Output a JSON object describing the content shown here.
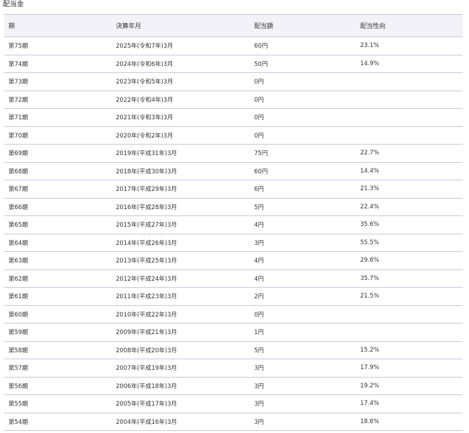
{
  "section_title": "配当金",
  "headers": [
    "期",
    "決算年月",
    "配当額",
    "配当性向"
  ],
  "rows": [
    {
      "period": "第75期",
      "fiscal": "2025年(令和7年)3月",
      "dividend": "60円",
      "payout": "23.1%"
    },
    {
      "period": "第74期",
      "fiscal": "2024年(令和6年)3月",
      "dividend": "50円",
      "payout": "14.9%"
    },
    {
      "period": "第73期",
      "fiscal": "2023年(令和5年)3月",
      "dividend": "0円",
      "payout": ""
    },
    {
      "period": "第72期",
      "fiscal": "2022年(令和4年)3月",
      "dividend": "0円",
      "payout": ""
    },
    {
      "period": "第71期",
      "fiscal": "2021年(令和3年)3月",
      "dividend": "0円",
      "payout": ""
    },
    {
      "period": "第70期",
      "fiscal": "2020年(令和2年)3月",
      "dividend": "0円",
      "payout": ""
    },
    {
      "period": "第69期",
      "fiscal": "2019年(平成31年)3月",
      "dividend": "75円",
      "payout": "22.7%"
    },
    {
      "period": "第68期",
      "fiscal": "2018年(平成30年)3月",
      "dividend": "60円",
      "payout": "14.4%"
    },
    {
      "period": "第67期",
      "fiscal": "2017年(平成29年)3月",
      "dividend": "6円",
      "payout": "21.3%"
    },
    {
      "period": "第66期",
      "fiscal": "2016年(平成28年)3月",
      "dividend": "5円",
      "payout": "22.4%"
    },
    {
      "period": "第65期",
      "fiscal": "2015年(平成27年)3月",
      "dividend": "4円",
      "payout": "35.6%"
    },
    {
      "period": "第64期",
      "fiscal": "2014年(平成26年)3月",
      "dividend": "3円",
      "payout": "55.5%"
    },
    {
      "period": "第63期",
      "fiscal": "2013年(平成25年)3月",
      "dividend": "4円",
      "payout": "29.6%"
    },
    {
      "period": "第62期",
      "fiscal": "2012年(平成24年)3月",
      "dividend": "4円",
      "payout": "35.7%"
    },
    {
      "period": "第61期",
      "fiscal": "2011年(平成23年)3月",
      "dividend": "2円",
      "payout": "21.5%"
    },
    {
      "period": "第60期",
      "fiscal": "2010年(平成22年)3月",
      "dividend": "0円",
      "payout": ""
    },
    {
      "period": "第59期",
      "fiscal": "2009年(平成21年)3月",
      "dividend": "1円",
      "payout": ""
    },
    {
      "period": "第58期",
      "fiscal": "2008年(平成20年)3月",
      "dividend": "5円",
      "payout": "15.2%"
    },
    {
      "period": "第57期",
      "fiscal": "2007年(平成19年)3月",
      "dividend": "3円",
      "payout": "17.9%"
    },
    {
      "period": "第56期",
      "fiscal": "2006年(平成18年)3月",
      "dividend": "3円",
      "payout": "19.2%"
    },
    {
      "period": "第55期",
      "fiscal": "2005年(平成17年)3月",
      "dividend": "3円",
      "payout": "17.4%"
    },
    {
      "period": "第54期",
      "fiscal": "2004年(平成16年)3月",
      "dividend": "3円",
      "payout": "18.6%"
    }
  ],
  "colors": {
    "header_bg": "#f2f2f8",
    "border": "#c8c8d8",
    "text": "#333333"
  }
}
